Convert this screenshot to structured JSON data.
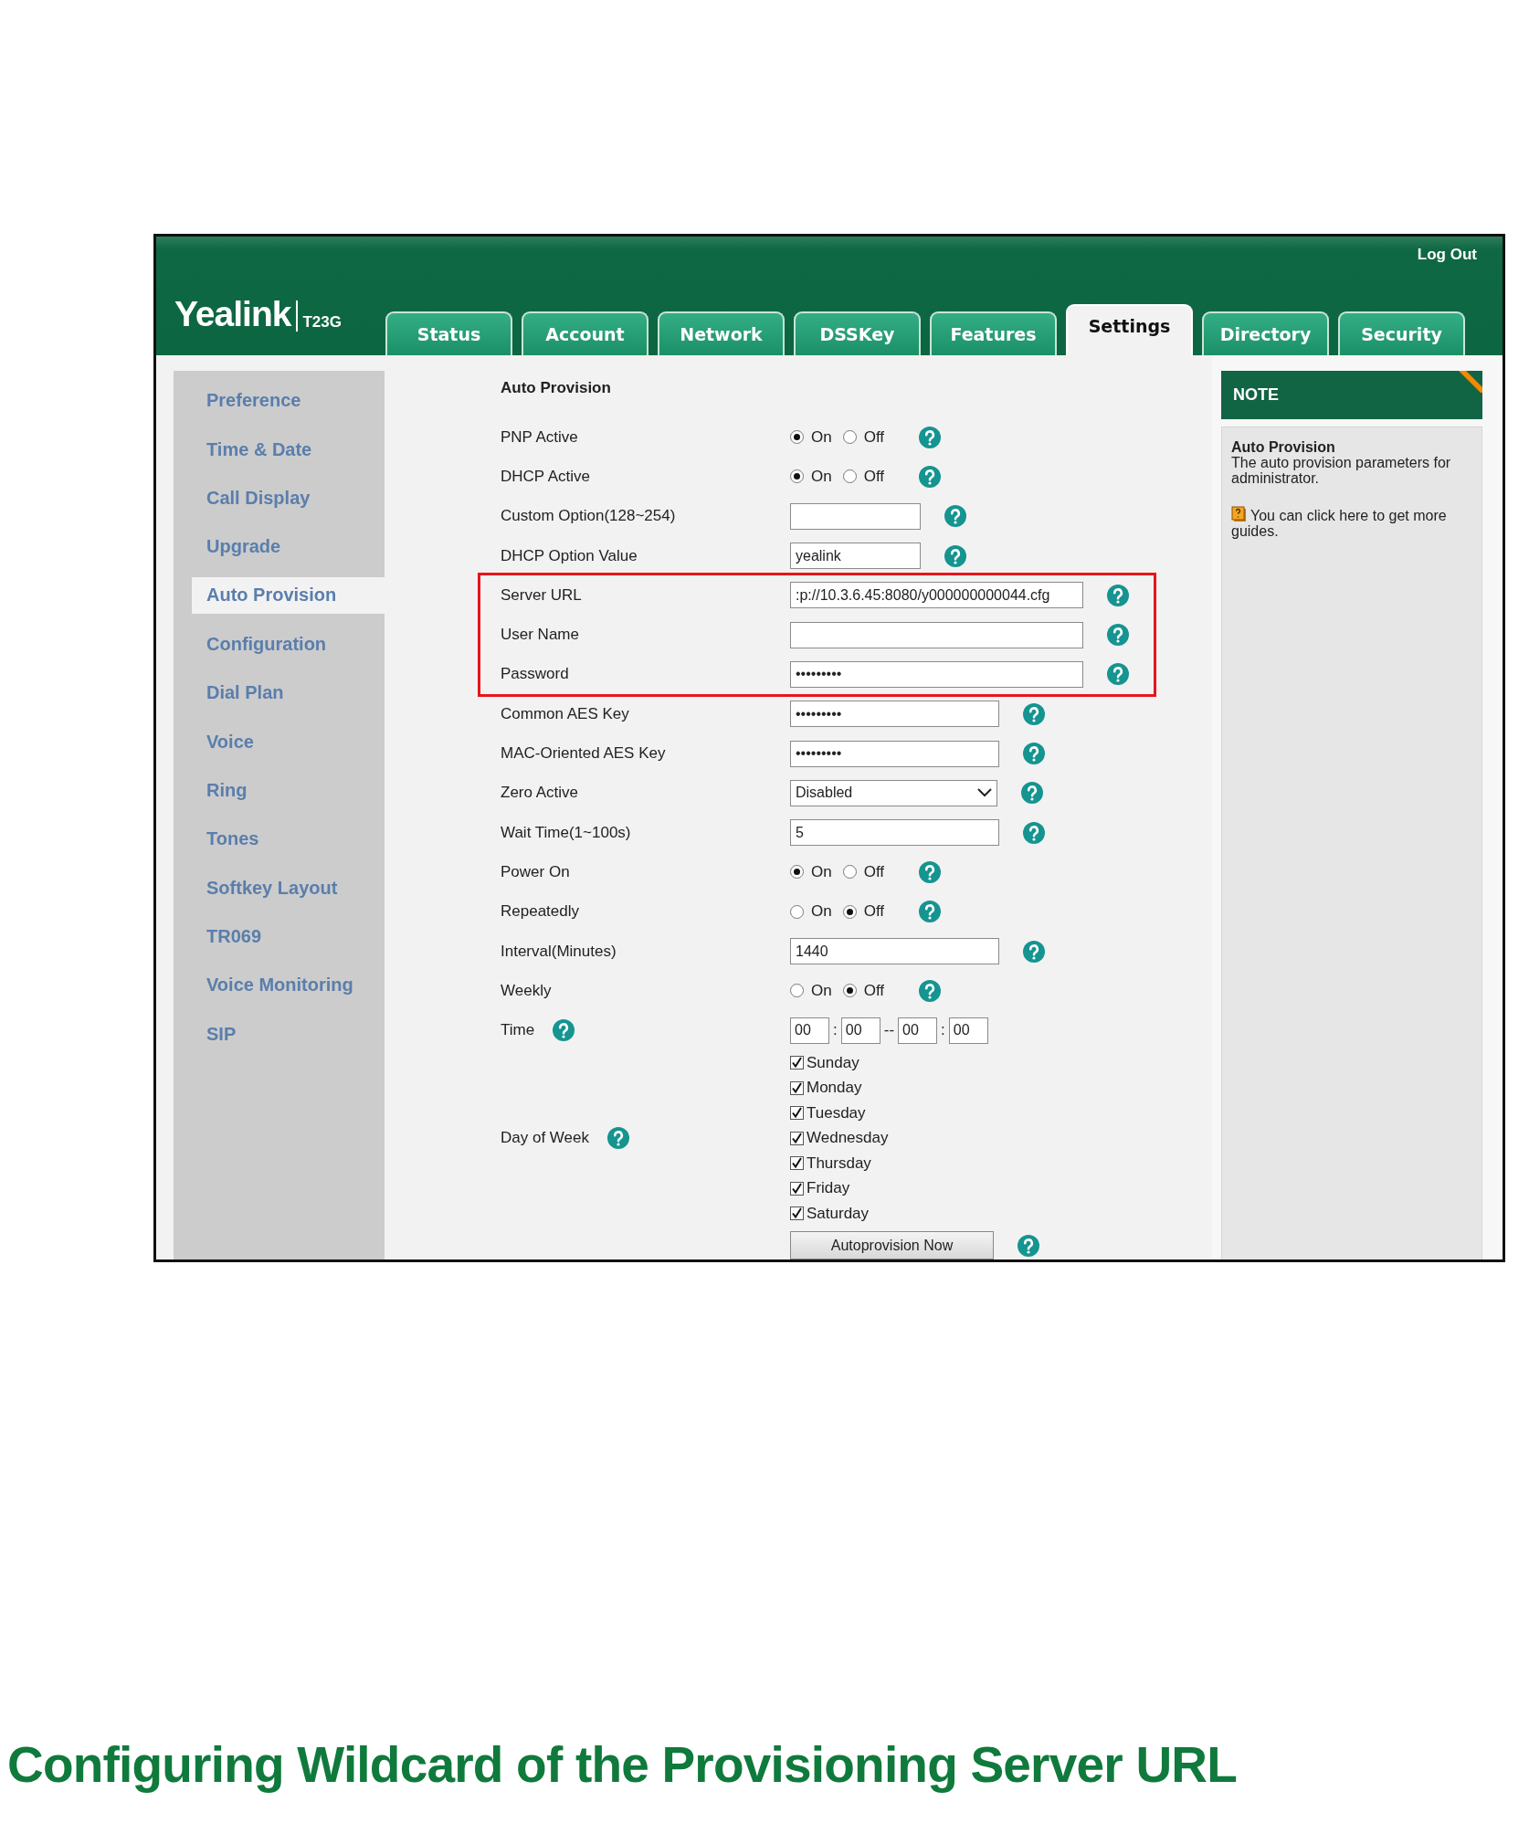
{
  "header": {
    "logo": "Yealink",
    "model": "T23G",
    "logout": "Log Out",
    "tabs": [
      {
        "label": "Status",
        "selected": false
      },
      {
        "label": "Account",
        "selected": false
      },
      {
        "label": "Network",
        "selected": false
      },
      {
        "label": "DSSKey",
        "selected": false
      },
      {
        "label": "Features",
        "selected": false
      },
      {
        "label": "Settings",
        "selected": true
      },
      {
        "label": "Directory",
        "selected": false
      },
      {
        "label": "Security",
        "selected": false
      }
    ]
  },
  "sidebar": {
    "items": [
      {
        "label": "Preference",
        "selected": false
      },
      {
        "label": "Time & Date",
        "selected": false
      },
      {
        "label": "Call Display",
        "selected": false
      },
      {
        "label": "Upgrade",
        "selected": false
      },
      {
        "label": "Auto Provision",
        "selected": true
      },
      {
        "label": "Configuration",
        "selected": false
      },
      {
        "label": "Dial Plan",
        "selected": false
      },
      {
        "label": "Voice",
        "selected": false
      },
      {
        "label": "Ring",
        "selected": false
      },
      {
        "label": "Tones",
        "selected": false
      },
      {
        "label": "Softkey Layout",
        "selected": false
      },
      {
        "label": "TR069",
        "selected": false
      },
      {
        "label": "Voice Monitoring",
        "selected": false
      },
      {
        "label": "SIP",
        "selected": false
      }
    ]
  },
  "form": {
    "title": "Auto Provision",
    "rows": [
      {
        "kind": "radio",
        "label": "PNP Active",
        "highlighted": false,
        "options": [
          {
            "label": "On",
            "selected": true
          },
          {
            "label": "Off",
            "selected": false
          }
        ]
      },
      {
        "kind": "radio",
        "label": "DHCP Active",
        "highlighted": false,
        "options": [
          {
            "label": "On",
            "selected": true
          },
          {
            "label": "Off",
            "selected": false
          }
        ]
      },
      {
        "kind": "short-field",
        "label": "Custom Option(128~254)",
        "highlighted": false
      },
      {
        "kind": "short-field",
        "label": "DHCP Option Value",
        "highlighted": false,
        "value": "yealink"
      },
      {
        "kind": "long-field",
        "label": "Server URL",
        "highlighted": true,
        "value": ":p://10.3.6.45:8080/y000000000044.cfg"
      },
      {
        "kind": "long-field",
        "label": "User Name",
        "highlighted": true
      },
      {
        "kind": "long-field",
        "label": "Password",
        "highlighted": true,
        "value": "•••••••••"
      },
      {
        "kind": "field",
        "label": "Common AES Key",
        "highlighted": false,
        "value": "•••••••••"
      },
      {
        "kind": "field",
        "label": "MAC-Oriented AES Key",
        "highlighted": false,
        "value": "•••••••••"
      },
      {
        "kind": "select",
        "label": "Zero Active",
        "highlighted": false,
        "value": "Disabled"
      },
      {
        "kind": "field",
        "label": "Wait Time(1~100s)",
        "highlighted": false,
        "value": "5"
      },
      {
        "kind": "radio",
        "label": "Power On",
        "highlighted": false,
        "options": [
          {
            "label": "On",
            "selected": true
          },
          {
            "label": "Off",
            "selected": false
          }
        ]
      },
      {
        "kind": "radio",
        "label": "Repeatedly",
        "highlighted": false,
        "options": [
          {
            "label": "On",
            "selected": false
          },
          {
            "label": "Off",
            "selected": true
          }
        ]
      },
      {
        "kind": "field",
        "label": "Interval(Minutes)",
        "highlighted": false,
        "value": "1440"
      },
      {
        "kind": "radio",
        "label": "Weekly",
        "highlighted": false,
        "options": [
          {
            "label": "On",
            "selected": false
          },
          {
            "label": "Off",
            "selected": true
          }
        ]
      },
      {
        "kind": "time",
        "label": "Time",
        "highlighted": false,
        "values": [
          "00",
          "00",
          "00",
          "00"
        ],
        "separators": [
          ":",
          "--",
          ":"
        ]
      },
      {
        "kind": "days",
        "label": "Day of Week",
        "highlighted": false,
        "days": [
          {
            "label": "Sunday",
            "checked": true
          },
          {
            "label": "Monday",
            "checked": true
          },
          {
            "label": "Tuesday",
            "checked": true
          },
          {
            "label": "Wednesday",
            "checked": true
          },
          {
            "label": "Thursday",
            "checked": true
          },
          {
            "label": "Friday",
            "checked": true
          },
          {
            "label": "Saturday",
            "checked": true
          }
        ]
      },
      {
        "kind": "button",
        "label": "Autoprovision Now",
        "highlighted": false
      }
    ]
  },
  "note": {
    "header": "NOTE",
    "title": "Auto Provision",
    "text": "The auto provision parameters for administrator.",
    "guide": "You can click here to get more guides."
  },
  "heading": "Configuring Wildcard of the Provisioning Server URL"
}
